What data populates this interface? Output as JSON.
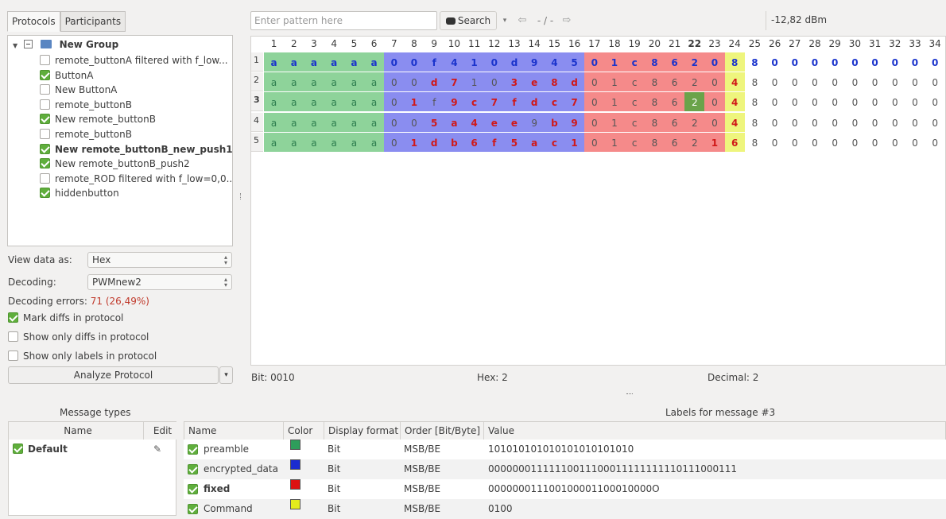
{
  "tabs": {
    "protocols": "Protocols",
    "participants": "Participants"
  },
  "tree": {
    "group": "New Group",
    "items": [
      {
        "label": "remote_buttonA filtered with f_low...",
        "checked": false,
        "bold": false
      },
      {
        "label": "ButtonA",
        "checked": true,
        "bold": false
      },
      {
        "label": "New ButtonA",
        "checked": false,
        "bold": false
      },
      {
        "label": "remote_buttonB",
        "checked": false,
        "bold": false
      },
      {
        "label": "New remote_buttonB",
        "checked": true,
        "bold": false
      },
      {
        "label": "remote_buttonB",
        "checked": false,
        "bold": false
      },
      {
        "label": "New remote_buttonB_new_push1",
        "checked": true,
        "bold": true
      },
      {
        "label": "New remote_buttonB_push2",
        "checked": true,
        "bold": false
      },
      {
        "label": "remote_ROD filtered with f_low=0,0...",
        "checked": false,
        "bold": false
      },
      {
        "label": "hiddenbutton",
        "checked": true,
        "bold": false
      }
    ]
  },
  "view": {
    "label": "View data as:",
    "value": "Hex"
  },
  "decoding": {
    "label": "Decoding:",
    "value": "PWMnew2"
  },
  "errors": {
    "label": "Decoding errors:",
    "value": "71 (26,49%)"
  },
  "options": {
    "mark_diffs": "Mark diffs in protocol",
    "only_diffs": "Show only diffs in protocol",
    "only_labels": "Show only labels in protocol"
  },
  "analyze": "Analyze Protocol",
  "search": {
    "placeholder": "Enter pattern here",
    "button": "Search",
    "counter": "-  /  -"
  },
  "rssi": "-12,82 dBm",
  "grid": {
    "current_col": 22,
    "current_row": 3,
    "columns": [
      "1",
      "2",
      "3",
      "4",
      "5",
      "6",
      "7",
      "8",
      "9",
      "10",
      "11",
      "12",
      "13",
      "14",
      "15",
      "16",
      "17",
      "18",
      "19",
      "20",
      "21",
      "22",
      "23",
      "24",
      "25",
      "26",
      "27",
      "28",
      "29",
      "30",
      "31",
      "32",
      "33",
      "34"
    ],
    "rows": [
      {
        "num": "1",
        "cells": [
          "a",
          "a",
          "a",
          "a",
          "a",
          "a",
          "0",
          "0",
          "f",
          "4",
          "1",
          "0",
          "d",
          "9",
          "4",
          "5",
          "0",
          "1",
          "c",
          "8",
          "6",
          "2",
          "0",
          "8",
          "8",
          "0",
          "0",
          "0",
          "0",
          "0",
          "0",
          "0",
          "0",
          "0"
        ]
      },
      {
        "num": "2",
        "cells": [
          "a",
          "a",
          "a",
          "a",
          "a",
          "a",
          "0",
          "0",
          "d",
          "7",
          "1",
          "0",
          "3",
          "e",
          "8",
          "d",
          "0",
          "1",
          "c",
          "8",
          "6",
          "2",
          "0",
          "4",
          "8",
          "0",
          "0",
          "0",
          "0",
          "0",
          "0",
          "0",
          "0",
          "0"
        ]
      },
      {
        "num": "3",
        "cells": [
          "a",
          "a",
          "a",
          "a",
          "a",
          "a",
          "0",
          "1",
          "f",
          "9",
          "c",
          "7",
          "f",
          "d",
          "c",
          "7",
          "0",
          "1",
          "c",
          "8",
          "6",
          "2",
          "0",
          "4",
          "8",
          "0",
          "0",
          "0",
          "0",
          "0",
          "0",
          "0",
          "0",
          "0"
        ]
      },
      {
        "num": "4",
        "cells": [
          "a",
          "a",
          "a",
          "a",
          "a",
          "a",
          "0",
          "0",
          "5",
          "a",
          "4",
          "e",
          "e",
          "9",
          "b",
          "9",
          "0",
          "1",
          "c",
          "8",
          "6",
          "2",
          "0",
          "4",
          "8",
          "0",
          "0",
          "0",
          "0",
          "0",
          "0",
          "0",
          "0",
          "0"
        ]
      },
      {
        "num": "5",
        "cells": [
          "a",
          "a",
          "a",
          "a",
          "a",
          "a",
          "0",
          "1",
          "d",
          "b",
          "6",
          "f",
          "5",
          "a",
          "c",
          "1",
          "0",
          "1",
          "c",
          "8",
          "6",
          "2",
          "1",
          "6",
          "8",
          "0",
          "0",
          "0",
          "0",
          "0",
          "0",
          "0",
          "0",
          "0"
        ]
      }
    ],
    "diffs": [
      [],
      [
        9,
        10,
        13,
        14,
        15,
        16,
        24
      ],
      [
        8,
        10,
        11,
        12,
        13,
        14,
        15,
        16,
        24
      ],
      [
        9,
        10,
        11,
        12,
        13,
        15,
        16,
        24
      ],
      [
        8,
        9,
        10,
        11,
        12,
        13,
        14,
        15,
        16,
        23,
        24
      ]
    ]
  },
  "bitinfo": {
    "bit": "Bit:  0010",
    "hex": "Hex:  2",
    "decimal": "Decimal:  2"
  },
  "message_types": {
    "title": "Message types",
    "col_name": "Name",
    "col_edit": "Edit",
    "items": [
      {
        "name": "Default",
        "checked": true
      }
    ]
  },
  "labels": {
    "title": "Labels for message #3",
    "headers": [
      "Name",
      "Color",
      "Display format",
      "Order [Bit/Byte]",
      "Value"
    ],
    "items": [
      {
        "name": "preamble",
        "color": "#2e9e5b",
        "format": "Bit",
        "order": "MSB/BE",
        "value": "101010101010101010101010",
        "bold": false
      },
      {
        "name": "encrypted_data",
        "color": "#1b2ccf",
        "format": "Bit",
        "order": "MSB/BE",
        "value": "00000001111110011100011111111110111000111",
        "bold": false
      },
      {
        "name": "fixed",
        "color": "#dd1111",
        "format": "Bit",
        "order": "MSB/BE",
        "value": "000000011100100001100010000O",
        "bold": true
      },
      {
        "name": "Command",
        "color": "#e3ec1d",
        "format": "Bit",
        "order": "MSB/BE",
        "value": "0100",
        "bold": false
      }
    ]
  },
  "colors": {
    "preamble_bg": "#8ed39a",
    "encrypted_bg": "#8a8df0",
    "fixed_bg": "#f58a8a",
    "command_bg": "#eef57d",
    "selected": "#6aa34a",
    "cell_blue": "#1a33cc",
    "cell_red": "#d01818",
    "cell_green": "#2d7d4e",
    "cell_gray": "#555555"
  }
}
